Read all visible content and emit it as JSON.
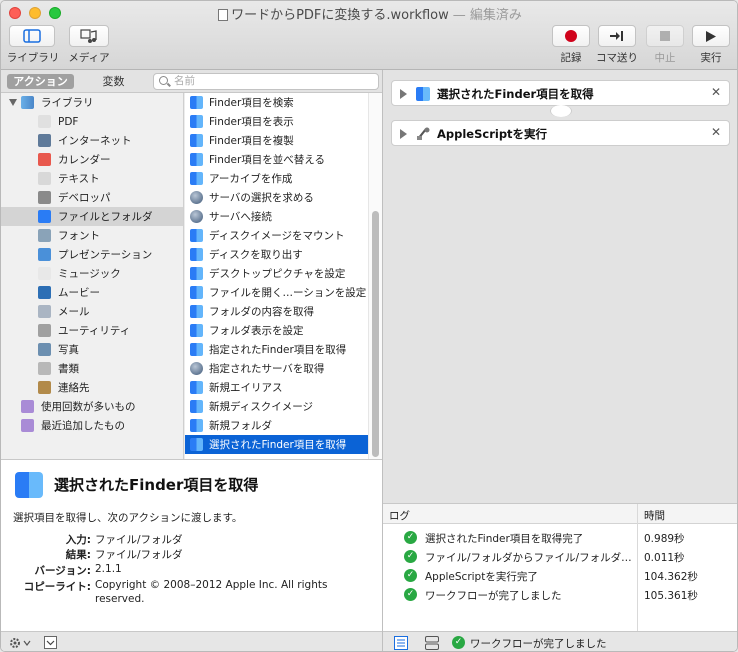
{
  "window": {
    "title": "ワードからPDFに変換する.workflow",
    "edited": "— 編集済み"
  },
  "toolbar": {
    "library": "ライブラリ",
    "media": "メディア",
    "record": "記録",
    "step": "コマ送り",
    "stop": "中止",
    "run": "実行"
  },
  "sidebar": {
    "tab_actions": "アクション",
    "tab_variables": "変数",
    "search_placeholder": "名前",
    "library_root": "ライブラリ",
    "categories": [
      "PDF",
      "インターネット",
      "カレンダー",
      "テキスト",
      "デベロッパ",
      "ファイルとフォルダ",
      "フォント",
      "プレゼンテーション",
      "ミュージック",
      "ムービー",
      "メール",
      "ユーティリティ",
      "写真",
      "書類",
      "連絡先"
    ],
    "smart_groups": [
      "使用回数が多いもの",
      "最近追加したもの"
    ]
  },
  "actions_list": [
    "Finder項目を検索",
    "Finder項目を表示",
    "Finder項目を複製",
    "Finder項目を並べ替える",
    "アーカイブを作成",
    "サーバの選択を求める",
    "サーバへ接続",
    "ディスクイメージをマウント",
    "ディスクを取り出す",
    "デスクトップピクチャを設定",
    "ファイルを開く…ーションを設定",
    "フォルダの内容を取得",
    "フォルダ表示を設定",
    "指定されたFinder項目を取得",
    "指定されたサーバを取得",
    "新規エイリアス",
    "新規ディスクイメージ",
    "新規フォルダ",
    "選択されたFinder項目を取得"
  ],
  "description": {
    "title": "選択されたFinder項目を取得",
    "text": "選択項目を取得し、次のアクションに渡します。",
    "input_label": "入力:",
    "input_value": "ファイル/フォルダ",
    "result_label": "結果:",
    "result_value": "ファイル/フォルダ",
    "version_label": "バージョン:",
    "version_value": "2.1.1",
    "copyright_label": "コピーライト:",
    "copyright_value_1": "Copyright © 2008–2012 Apple Inc.  All rights",
    "copyright_value_2": "reserved."
  },
  "workflow": {
    "actions": [
      {
        "title": "選択されたFinder項目を取得"
      },
      {
        "title": "AppleScriptを実行"
      }
    ]
  },
  "log": {
    "col_log": "ログ",
    "col_time": "時間",
    "rows": [
      {
        "msg": "選択されたFinder項目を取得完了",
        "time": "0.989秒"
      },
      {
        "msg": "ファイル/フォルダからファイル/フォルダの…",
        "time": "0.011秒"
      },
      {
        "msg": "AppleScriptを実行完了",
        "time": "104.362秒"
      },
      {
        "msg": "ワークフローが完了しました",
        "time": "105.361秒"
      }
    ]
  },
  "status": {
    "message": "ワークフローが完了しました"
  },
  "colors": {
    "selection": "#0b63d6",
    "success": "#29a843",
    "record": "#d0021b"
  }
}
